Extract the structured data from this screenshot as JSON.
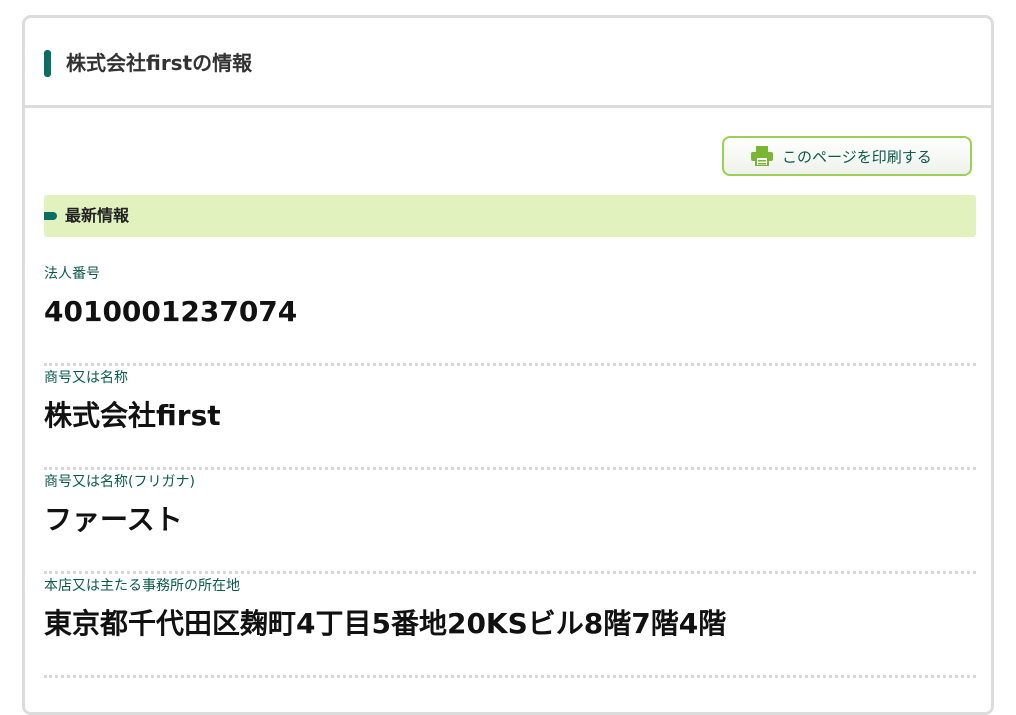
{
  "header": {
    "title": "株式会社firstの情報"
  },
  "toolbar": {
    "print_label": "このページを印刷する",
    "print_icon": "printer-icon"
  },
  "section": {
    "title": "最新情報"
  },
  "fields": [
    {
      "label": "法人番号",
      "value": "4010001237074"
    },
    {
      "label": "商号又は名称",
      "value": "株式会社first"
    },
    {
      "label": "商号又は名称(フリガナ)",
      "value": "ファースト"
    },
    {
      "label": "本店又は主たる事務所の所在地",
      "value": "東京都千代田区麹町4丁目5番地20KSビル8階7階4階"
    }
  ],
  "colors": {
    "accent": "#0a6e64",
    "section_bg": "#e1f2bf",
    "button_border": "#9ccf55",
    "printer_icon": "#7ab534"
  }
}
